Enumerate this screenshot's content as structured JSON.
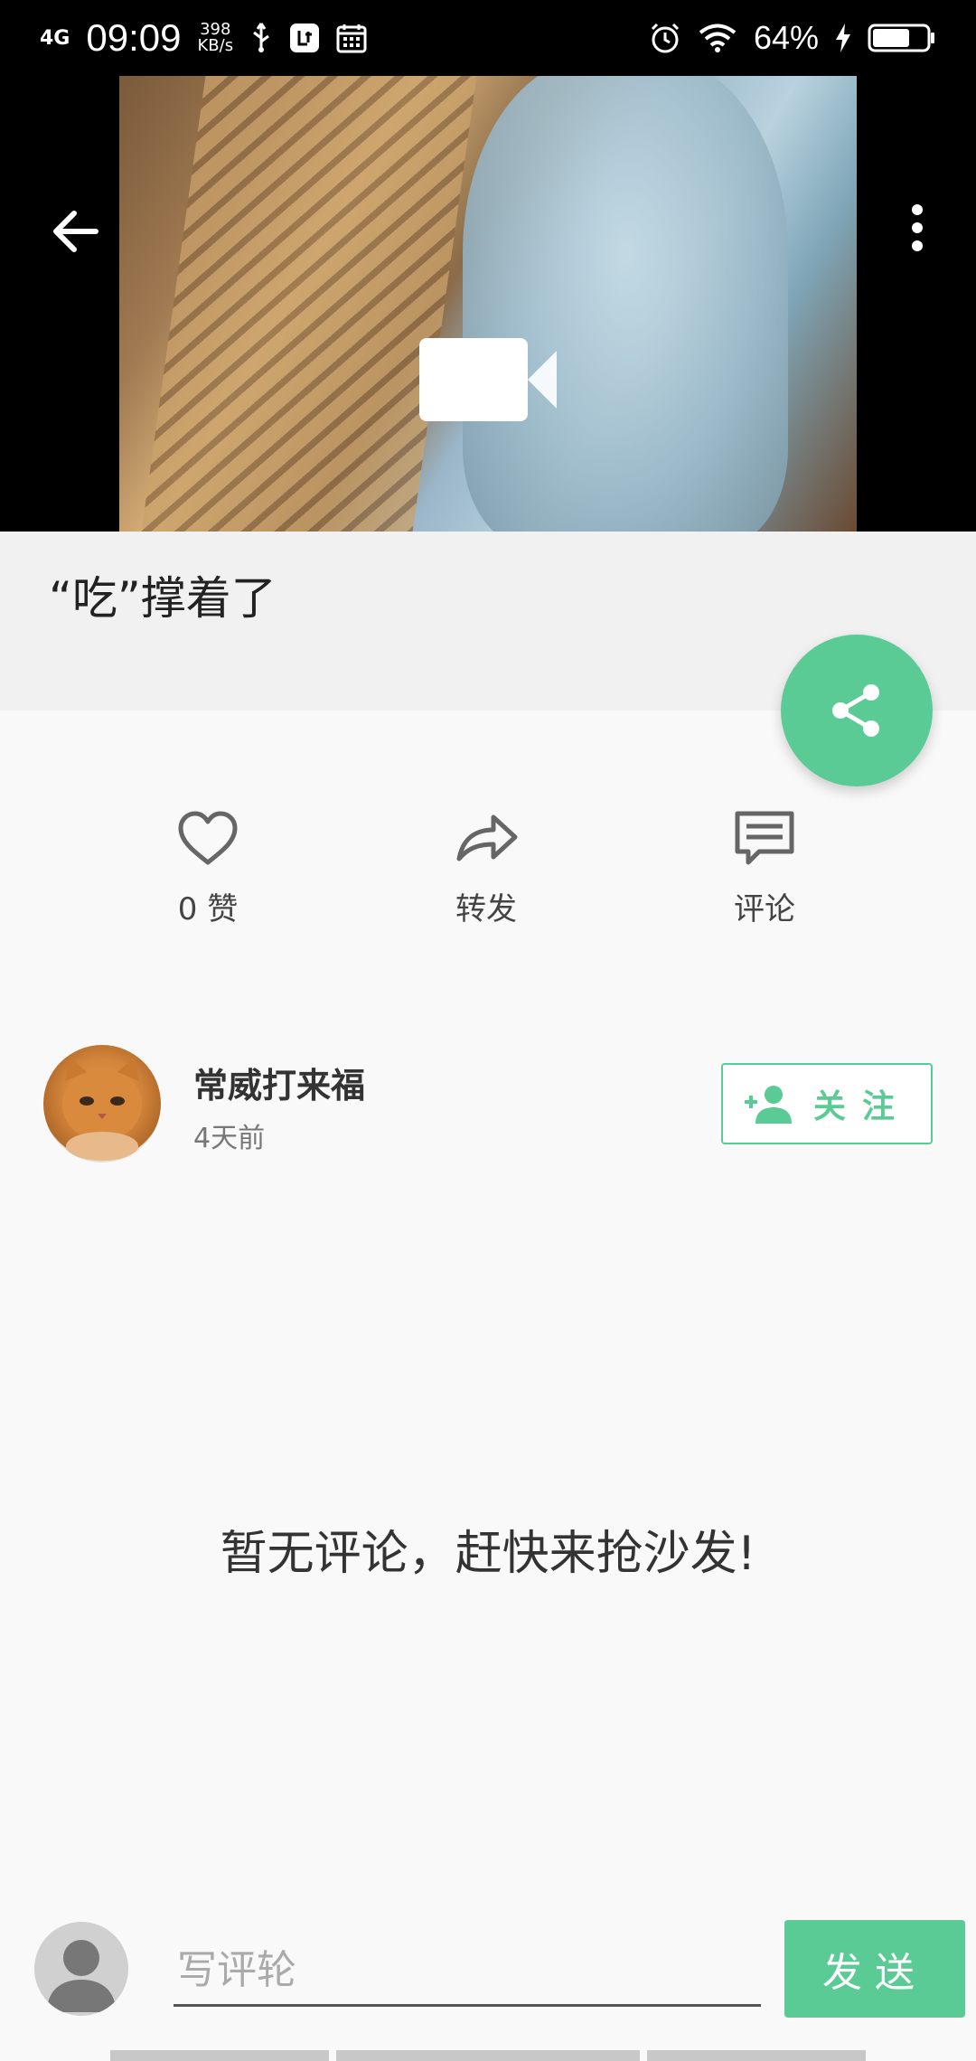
{
  "status_bar": {
    "signal": "4G",
    "time": "09:09",
    "net_speed_value": "398",
    "net_speed_unit": "KB/s",
    "battery_percent": "64%",
    "icons": [
      "usb-icon",
      "app-notification-icon",
      "calendar-icon",
      "alarm-icon",
      "wifi-icon",
      "charging-icon",
      "battery-icon"
    ]
  },
  "video": {
    "icons": {
      "back": "arrow-left-icon",
      "more": "more-vertical-icon",
      "play": "video-camera-icon"
    }
  },
  "post": {
    "title": "“吃”撑着了"
  },
  "fab": {
    "icon": "share-icon",
    "color": "#5acb95"
  },
  "actions": [
    {
      "icon": "heart-icon",
      "label": "0 赞"
    },
    {
      "icon": "forward-icon",
      "label": "转发"
    },
    {
      "icon": "comment-icon",
      "label": "评论"
    }
  ],
  "author": {
    "name": "常威打来福",
    "time_ago": "4天前",
    "follow_label": "关注",
    "follow_icon": "add-person-icon"
  },
  "comments": {
    "empty_text": "暂无评论，赶快来抢沙发!"
  },
  "comment_bar": {
    "placeholder": "写评轮",
    "send_label": "发送"
  },
  "colors": {
    "accent": "#5acb95",
    "status_bg": "#000000",
    "title_band": "#f1f1f1",
    "page_bg": "#f9f9f9"
  }
}
